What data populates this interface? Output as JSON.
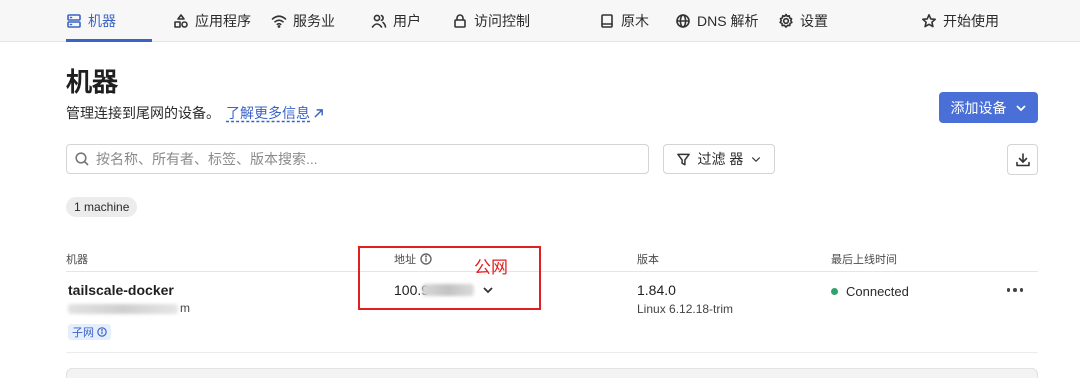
{
  "nav": {
    "items": [
      {
        "label": "机器",
        "icon": "machines-icon",
        "active": true
      },
      {
        "label": "应用程序",
        "icon": "apps-icon"
      },
      {
        "label": "服务业",
        "icon": "services-icon"
      },
      {
        "label": "用户",
        "icon": "users-icon"
      },
      {
        "label": "访问控制",
        "icon": "lock-icon"
      },
      {
        "label": "原木",
        "icon": "logs-icon"
      },
      {
        "label": "DNS 解析",
        "icon": "globe-icon"
      },
      {
        "label": "设置",
        "icon": "gear-icon"
      },
      {
        "label": "开始使用",
        "icon": "star-icon"
      }
    ]
  },
  "header": {
    "title": "机器",
    "subtitle": "管理连接到尾网的设备。",
    "learn_more": "了解更多信息",
    "add_device": "添加设备"
  },
  "search": {
    "placeholder": "按名称、所有者、标签、版本搜索..."
  },
  "filter": {
    "label": "过滤 器"
  },
  "count_badge": "1 machine",
  "table": {
    "columns": {
      "machine": "机器",
      "address": "地址",
      "version": "版本",
      "last_seen": "最后上线时间"
    },
    "rows": [
      {
        "name": "tailscale-docker",
        "owner_tail": "m",
        "badge": "子网",
        "address": "100.9",
        "version": "1.84.0",
        "os": "Linux 6.12.18-trim",
        "status": "Connected",
        "status_color": "#2ea36b"
      }
    ]
  },
  "annotation": {
    "label": "公网",
    "color": "#e02020"
  },
  "colors": {
    "accent": "#3a63c8",
    "button": "#4a6fd6"
  }
}
